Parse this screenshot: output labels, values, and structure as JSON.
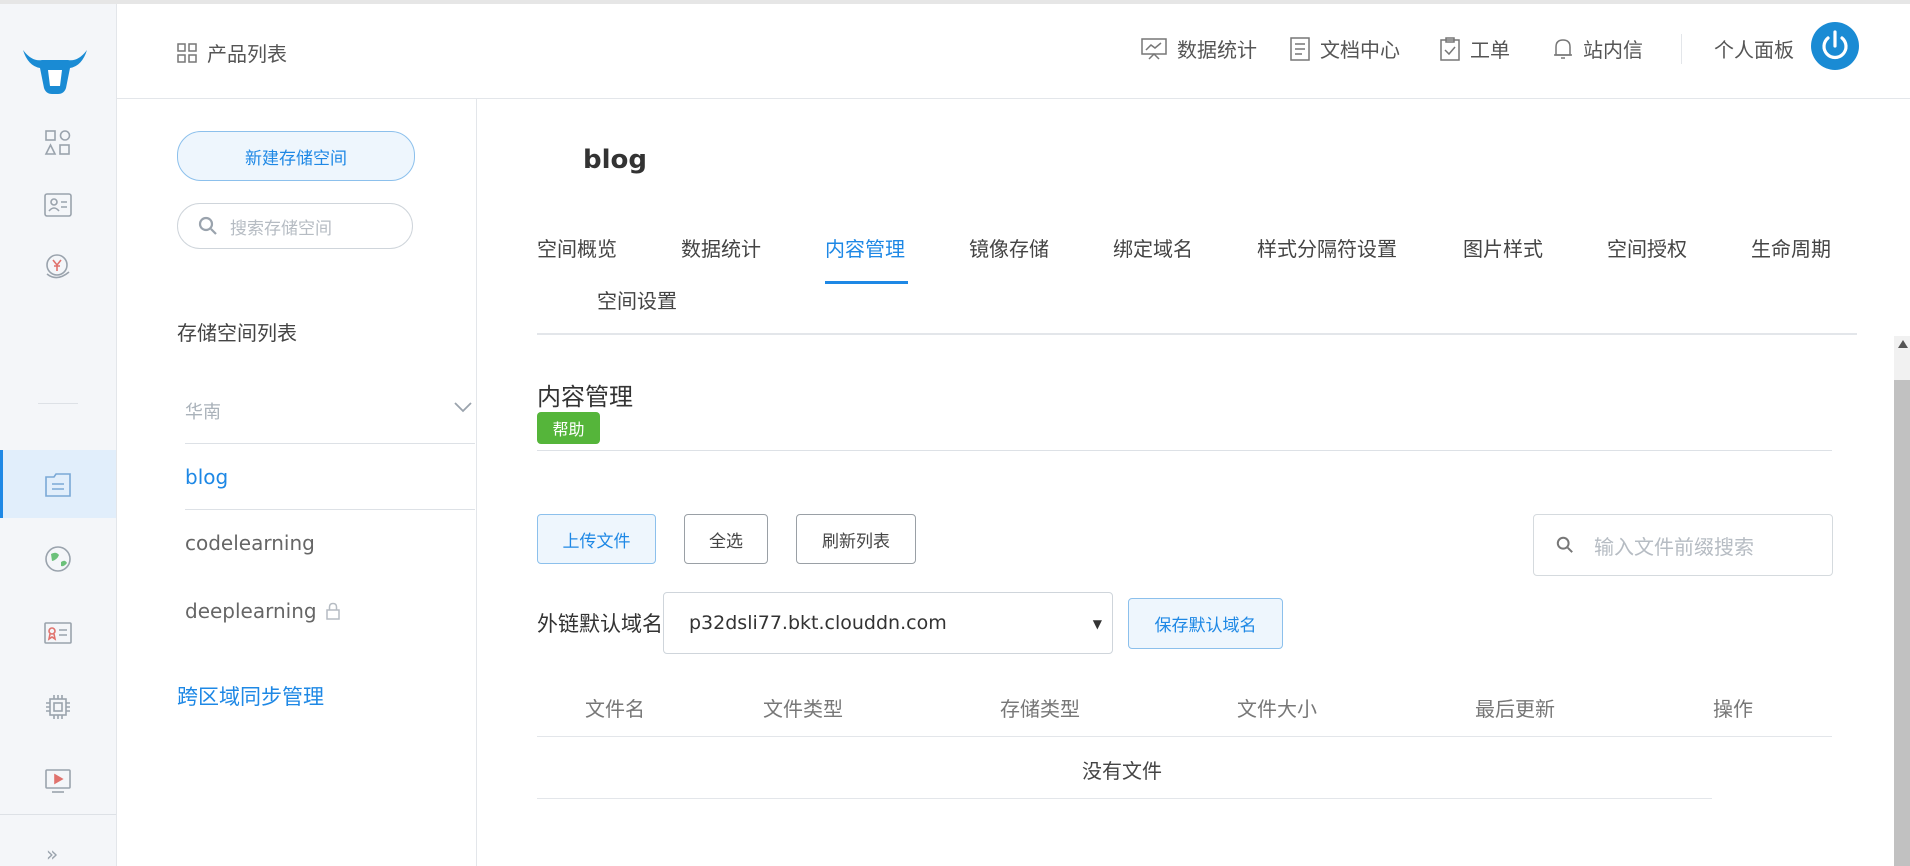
{
  "header": {
    "product_list": "产品列表",
    "nav": [
      {
        "label": "数据统计",
        "icon": "chart-board-icon"
      },
      {
        "label": "文档中心",
        "icon": "document-icon"
      },
      {
        "label": "工单",
        "icon": "clipboard-icon"
      },
      {
        "label": "站内信",
        "icon": "bell-icon"
      }
    ],
    "personal_panel": "个人面板"
  },
  "sidebar_rail": {
    "icons": [
      "logo-icon",
      "product-grid-icon",
      "contact-card-icon",
      "finance-icon",
      "storage-icon",
      "cdn-globe-icon",
      "certificate-icon",
      "chip-icon",
      "media-icon",
      "expand-icon"
    ],
    "active": "storage-icon"
  },
  "bucket_panel": {
    "new_bucket": "新建存储空间",
    "search_placeholder": "搜索存储空间",
    "list_title": "存储空间列表",
    "region": "华南",
    "buckets": [
      {
        "name": "blog",
        "active": true,
        "locked": false
      },
      {
        "name": "codelearning",
        "active": false,
        "locked": false
      },
      {
        "name": "deeplearning",
        "active": false,
        "locked": true
      }
    ],
    "cross_region": "跨区域同步管理"
  },
  "main": {
    "bucket_name": "blog",
    "tabs": [
      {
        "label": "空间概览"
      },
      {
        "label": "数据统计"
      },
      {
        "label": "内容管理",
        "active": true
      },
      {
        "label": "镜像存储"
      },
      {
        "label": "绑定域名"
      },
      {
        "label": "样式分隔符设置"
      },
      {
        "label": "图片样式"
      },
      {
        "label": "空间授权"
      },
      {
        "label": "生命周期"
      },
      {
        "label": "空间设置"
      }
    ],
    "section_title": "内容管理",
    "help": "帮助",
    "buttons": {
      "upload": "上传文件",
      "select_all": "全选",
      "refresh": "刷新列表"
    },
    "file_search_placeholder": "输入文件前缀搜索",
    "domain_label": "外链默认域名",
    "domain_value": "p32dsli77.bkt.clouddn.com",
    "save_domain": "保存默认域名",
    "table_headers": [
      "文件名",
      "文件类型",
      "存储类型",
      "文件大小",
      "最后更新",
      "操作"
    ],
    "empty_text": "没有文件"
  },
  "colors": {
    "accent": "#1e88e5",
    "help_green": "#55b53a",
    "rail_bg": "#f4f6f9"
  }
}
